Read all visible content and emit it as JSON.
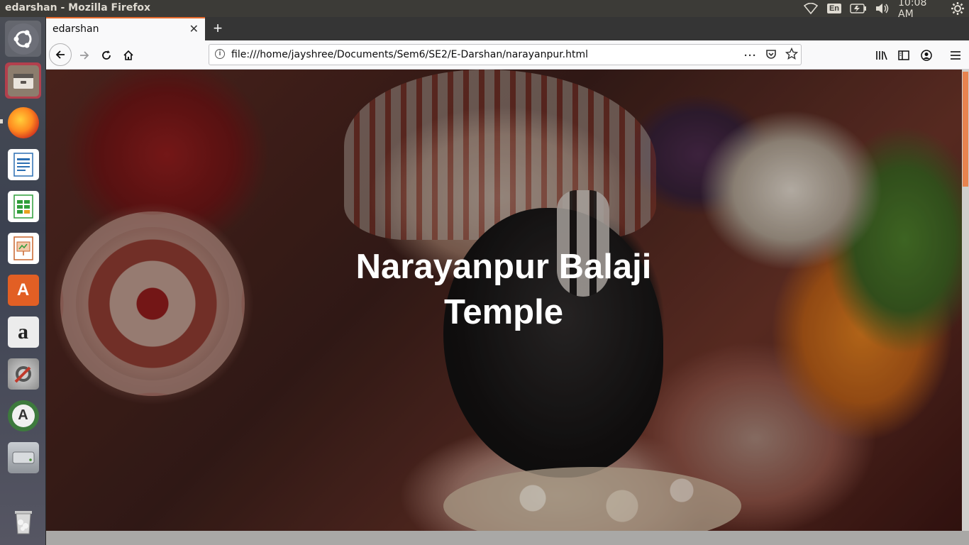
{
  "system_bar": {
    "window_title": "edarshan - Mozilla Firefox",
    "keyboard_layout": "En",
    "clock": "10:08 AM",
    "icons": [
      "wifi-icon",
      "battery-icon",
      "volume-icon",
      "settings-gear-icon"
    ]
  },
  "launcher": {
    "items": [
      {
        "name": "ubuntu-dash-icon",
        "color": "#7a7f8a"
      },
      {
        "name": "files-icon",
        "color": "#7b6f63"
      },
      {
        "name": "firefox-icon",
        "color": "#e66a2c"
      },
      {
        "name": "libreoffice-writer-icon",
        "color": "#2b6fb3"
      },
      {
        "name": "libreoffice-calc-icon",
        "color": "#2f9d3a"
      },
      {
        "name": "libreoffice-impress-icon",
        "color": "#c8642c"
      },
      {
        "name": "software-center-icon",
        "color": "#e25f24"
      },
      {
        "name": "amazon-icon",
        "color": "#e6e6e6"
      },
      {
        "name": "system-settings-icon",
        "color": "#8b8b8b"
      },
      {
        "name": "software-updater-icon",
        "color": "#3d7a3d"
      },
      {
        "name": "disk-drive-icon",
        "color": "#9da1a6"
      },
      {
        "name": "trash-icon",
        "color": "#8a8a8a"
      }
    ]
  },
  "browser": {
    "tab": {
      "label": "edarshan"
    },
    "new_tab_label": "+",
    "url": "file:///home/jayshree/Documents/Sem6/SE2/E-Darshan/narayanpur.html",
    "accent_color": "#e66a2c"
  },
  "page": {
    "title": "Narayanpur Balaji Temple"
  }
}
